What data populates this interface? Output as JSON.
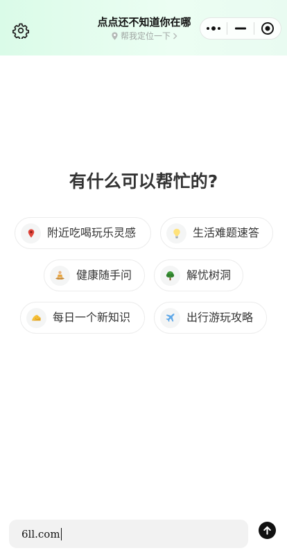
{
  "header": {
    "title": "点点还不知道你在哪",
    "locate_label": "帮我定位一下",
    "icons": {
      "settings": "gear-icon",
      "locate": "location-pin-icon",
      "chevron": "chevron-right-icon",
      "more": "more-dots-icon",
      "minimize": "minimize-icon",
      "close": "close-target-icon"
    }
  },
  "main": {
    "heading": "有什么可以帮忙的?",
    "suggestions": [
      {
        "label": "附近吃喝玩乐灵感",
        "icon": "location-pin-icon"
      },
      {
        "label": "生活难题速答",
        "icon": "lightbulb-icon"
      },
      {
        "label": "健康随手问",
        "icon": "meditation-icon"
      },
      {
        "label": "解忧树洞",
        "icon": "tree-icon"
      },
      {
        "label": "每日一个新知识",
        "icon": "cheese-icon"
      },
      {
        "label": "出行游玩攻略",
        "icon": "airplane-icon"
      }
    ]
  },
  "input": {
    "value": "6ll.com",
    "send_icon": "send-arrow-up-icon"
  },
  "colors": {
    "header_bg": "#dafbe8",
    "send_button": "#111111",
    "pin": "#e0463b"
  }
}
